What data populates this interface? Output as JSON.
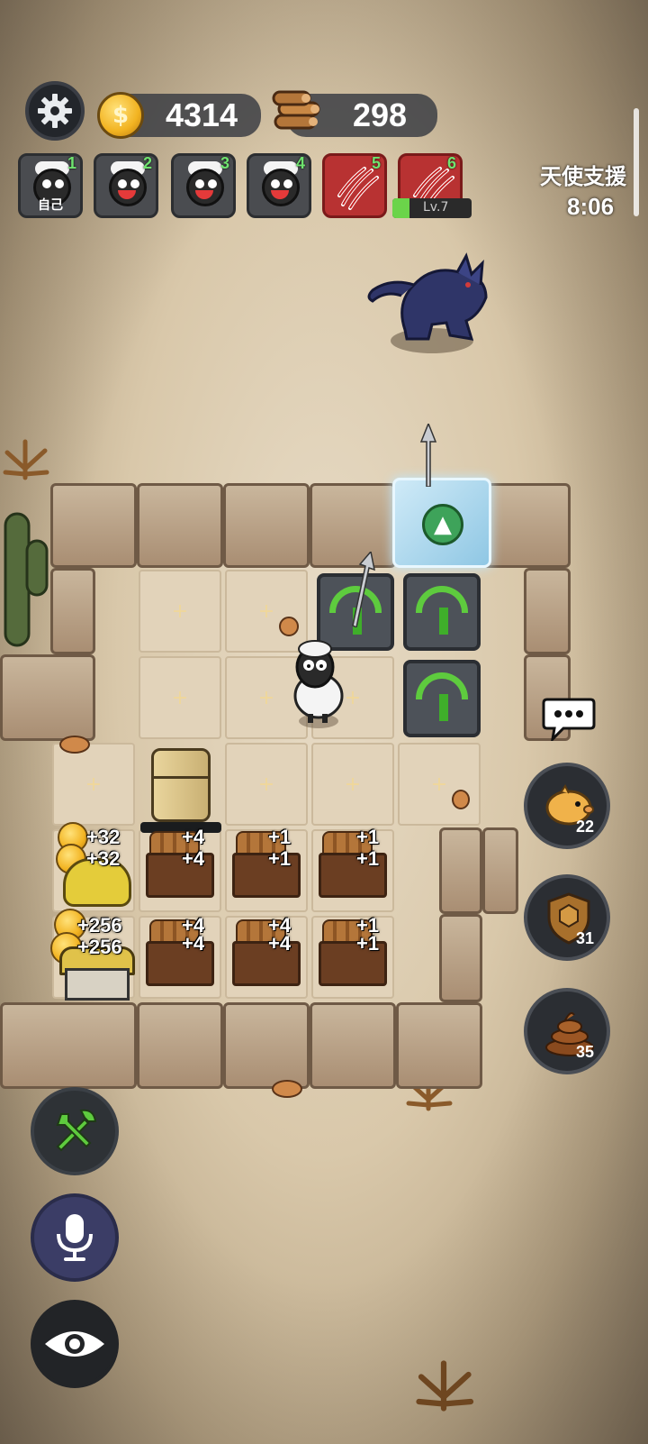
{
  "hud": {
    "gold": "4314",
    "wood": "298",
    "settings_icon": "gear-icon"
  },
  "players": [
    {
      "num": "1",
      "label": "自己",
      "type": "sheep-self"
    },
    {
      "num": "2",
      "type": "sheep"
    },
    {
      "num": "3",
      "type": "sheep"
    },
    {
      "num": "4",
      "type": "sheep"
    },
    {
      "num": "5",
      "type": "claw"
    },
    {
      "num": "6",
      "type": "claw"
    }
  ],
  "angel_support": {
    "title": "天使支援",
    "timer": "8:06"
  },
  "enemy_level_tag": "Lv.7",
  "gains": {
    "g1a": "+32",
    "g1b": "+32",
    "g2a": "+4",
    "g2b": "+4",
    "g3a": "+1",
    "g3b": "+1",
    "g4a": "+1",
    "g4b": "+1",
    "g5a": "+256",
    "g5b": "+256",
    "g6a": "+4",
    "g6b": "+4",
    "g7a": "+4",
    "g7b": "+4",
    "g8a": "+1",
    "g8b": "+1"
  },
  "side_buttons": [
    {
      "name": "piggy-bank-button",
      "icon": "piggy-bank-icon",
      "count": "22"
    },
    {
      "name": "shield-button",
      "icon": "shield-icon",
      "count": "31"
    },
    {
      "name": "poop-button",
      "icon": "poop-icon",
      "count": "35"
    }
  ],
  "tile_plus": "+",
  "colors": {
    "accent_green": "#5ecb3e",
    "gold": "#f2b321",
    "enemy_red": "#b83232"
  }
}
